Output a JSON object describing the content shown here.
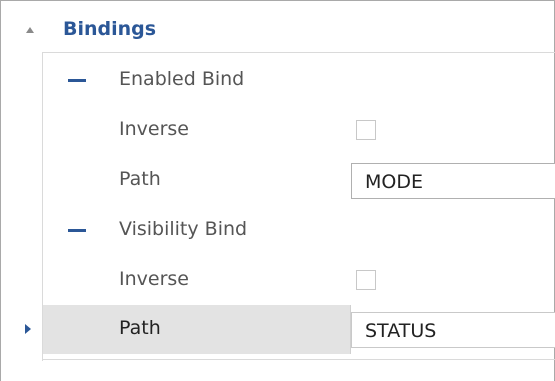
{
  "property_grid": {
    "category": {
      "title": "Bindings",
      "expanded": true
    },
    "rows": [
      {
        "kind": "group",
        "label": "Enabled Bind",
        "expanded": true
      },
      {
        "kind": "checkbox",
        "label": "Inverse",
        "checked": false
      },
      {
        "kind": "dropdown",
        "label": "Path",
        "value": "MODE"
      },
      {
        "kind": "group",
        "label": "Visibility Bind",
        "expanded": true
      },
      {
        "kind": "checkbox",
        "label": "Inverse",
        "checked": false
      },
      {
        "kind": "dropdown",
        "label": "Path",
        "value": "STATUS",
        "selected": true
      }
    ]
  },
  "colors": {
    "category_title": "#2b5797",
    "selection_background": "#e3e3e3",
    "toggle_accent": "#2b5797"
  },
  "icons": {
    "category_toggle": "caret-up-icon",
    "group_toggle": "collapse-minus-icon",
    "row_pointer": "triangle-right-icon",
    "dropdown": "chevron-down-icon"
  }
}
